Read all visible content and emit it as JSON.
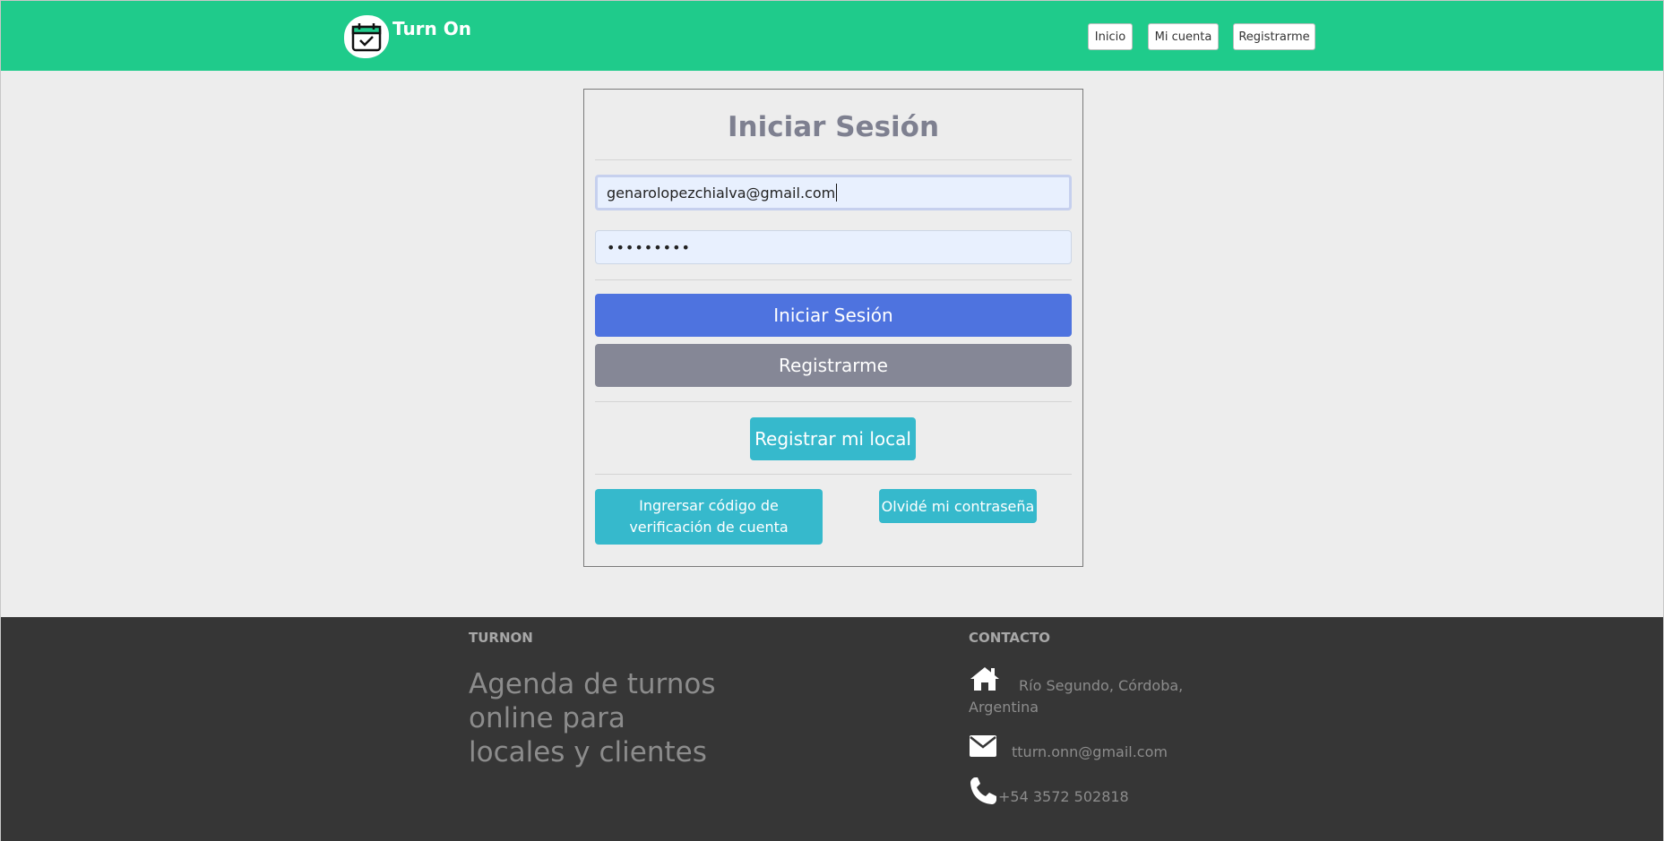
{
  "navbar": {
    "brand": "Turn On",
    "logo_icon": "calendar-check-icon",
    "links": [
      "Inicio",
      "Mi cuenta",
      "Registrarme"
    ]
  },
  "login": {
    "title": "Iniciar Sesión",
    "email_value": "genarolopezchialva@gmail.com",
    "password_value": "•••••••••",
    "submit_label": "Iniciar Sesión",
    "register_label": "Registrarme",
    "register_local_label": "Registrar mi local",
    "verify_code_label": "Ingrersar código de verificación de cuenta",
    "forgot_password_label": "Olvidé mi contraseña"
  },
  "footer": {
    "brand_heading": "TURNON",
    "tagline": [
      "Agenda de turnos",
      "online para",
      "locales y clientes"
    ],
    "contact_heading": "CONTACTO",
    "address": [
      "Río Segundo, Córdoba,",
      "Argentina"
    ],
    "email": "tturn.onn@gmail.com",
    "phone": "+54 3572 502818"
  },
  "colors": {
    "navbar": "#1fcb8b",
    "primary": "#4e73df",
    "secondary": "#858796",
    "info": "#36b9cc",
    "footer": "#363636"
  }
}
